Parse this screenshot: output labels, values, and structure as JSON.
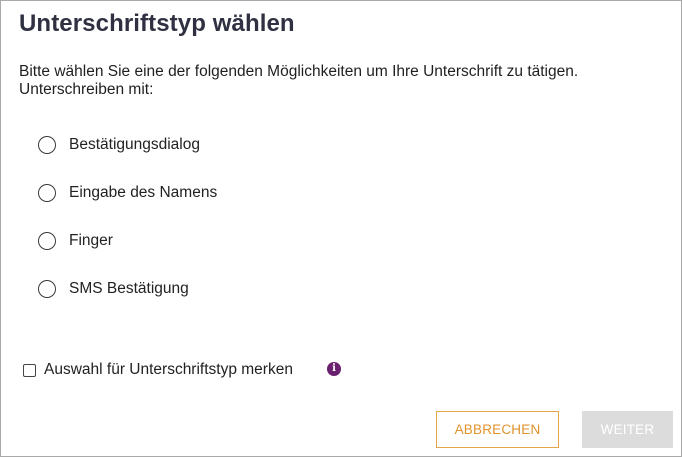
{
  "dialog": {
    "title": "Unterschriftstyp wählen",
    "description": "Bitte wählen Sie eine der folgenden Möglichkeiten um Ihre Unterschrift zu tätigen. Unterschreiben mit:",
    "options": [
      {
        "label": "Bestätigungsdialog",
        "selected": false
      },
      {
        "label": "Eingabe des Namens",
        "selected": false
      },
      {
        "label": "Finger",
        "selected": false
      },
      {
        "label": "SMS Bestätigung",
        "selected": false
      }
    ],
    "remember": {
      "label": "Auswahl für Unterschriftstyp merken",
      "checked": false
    },
    "info_icon": "info-icon",
    "buttons": {
      "cancel_label": "ABBRECHEN",
      "next_label": "WEITER",
      "next_enabled": false
    },
    "colors": {
      "title": "#2f3041",
      "accent_orange": "#e0932c",
      "info_purple": "#6b1f6f",
      "disabled_button": "#dcdcdc"
    }
  }
}
